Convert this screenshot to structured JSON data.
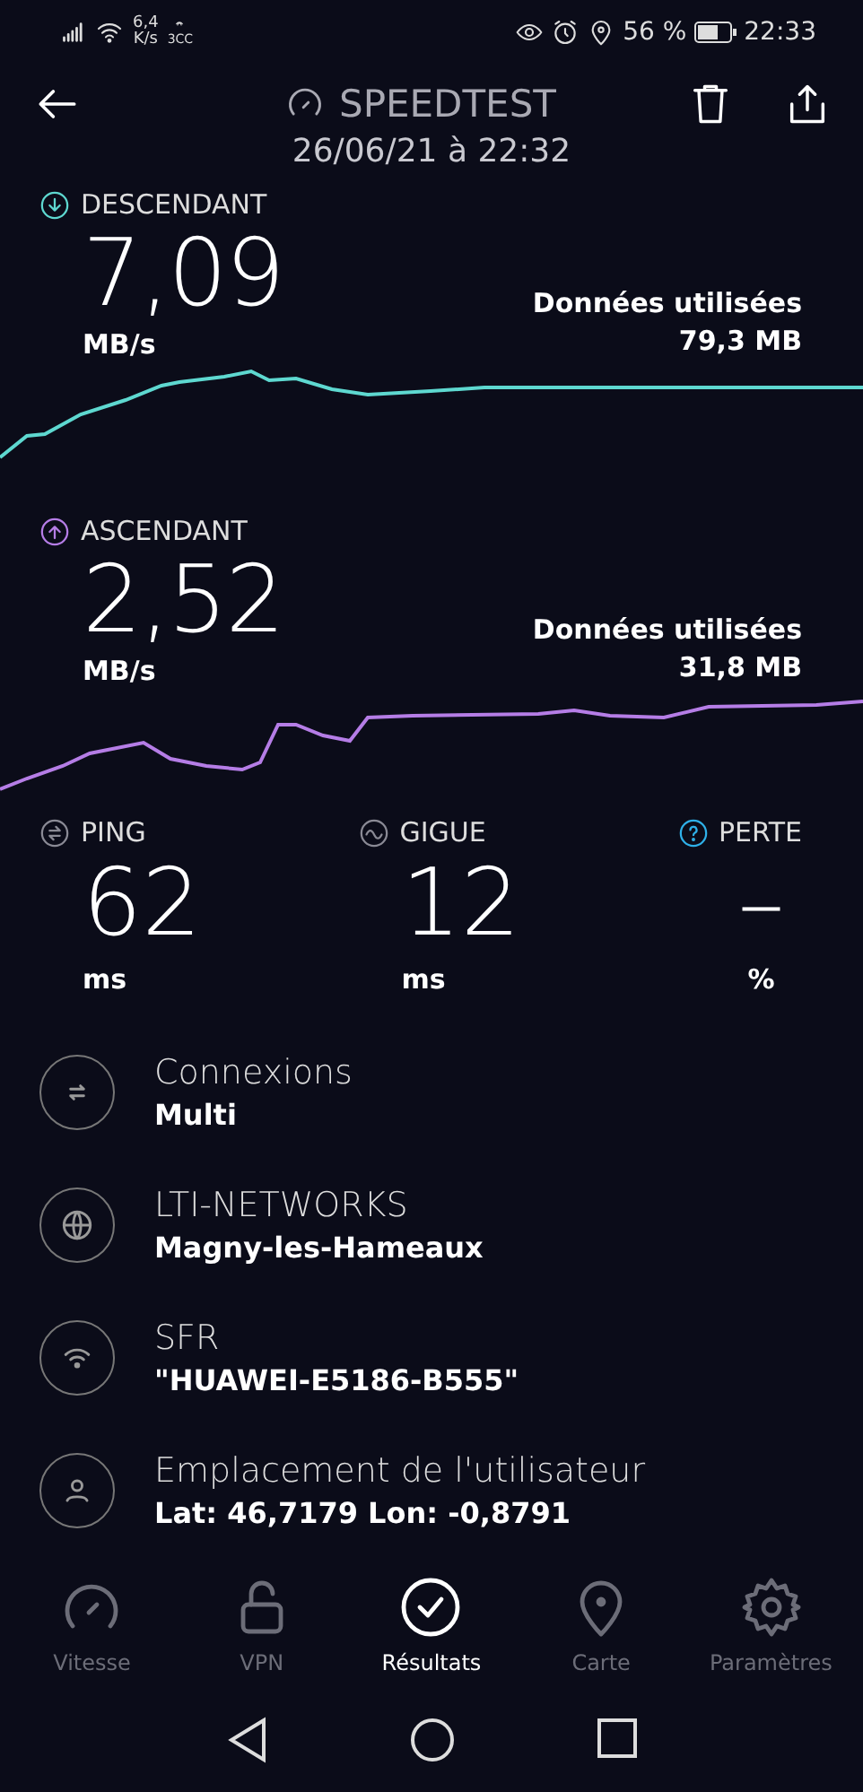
{
  "status_bar": {
    "speed": "6,4",
    "speed_unit": "K/s",
    "badge": "3CC",
    "battery": "56 %",
    "time": "22:33"
  },
  "header": {
    "title": "SPEEDTEST",
    "date": "26/06/21 à 22:32"
  },
  "tests": [
    {
      "kind": "download",
      "label": "DESCENDANT",
      "value": "7,09",
      "unit": "MB/s",
      "data_label": "Données utilisées",
      "data_value": "79,3 MB",
      "color": "#5ed8d0"
    },
    {
      "kind": "upload",
      "label": "ASCENDANT",
      "value": "2,52",
      "unit": "MB/s",
      "data_label": "Données utilisées",
      "data_value": "31,8 MB",
      "color": "#b57de6"
    }
  ],
  "metrics": [
    {
      "kind": "ping",
      "label": "PING",
      "value": "62",
      "unit": "ms"
    },
    {
      "kind": "jitter",
      "label": "GIGUE",
      "value": "12",
      "unit": "ms"
    },
    {
      "kind": "loss",
      "label": "PERTE",
      "value": "–",
      "unit": "%"
    }
  ],
  "details": [
    {
      "kind": "connections",
      "title": "Connexions",
      "subtitle": "Multi"
    },
    {
      "kind": "server",
      "title": "LTI-NETWORKS",
      "subtitle": "Magny-les-Hameaux"
    },
    {
      "kind": "wifi",
      "title": "SFR",
      "subtitle": "\"HUAWEI-E5186-B555\""
    },
    {
      "kind": "user",
      "title": "Emplacement de l'utilisateur",
      "subtitle": "Lat: 46,7179 Lon: -0,8791"
    }
  ],
  "tabs": [
    {
      "kind": "speed",
      "label": "Vitesse",
      "selected": false
    },
    {
      "kind": "vpn",
      "label": "VPN",
      "selected": false
    },
    {
      "kind": "results",
      "label": "Résultats",
      "selected": true
    },
    {
      "kind": "map",
      "label": "Carte",
      "selected": false
    },
    {
      "kind": "settings",
      "label": "Paramètres",
      "selected": false
    }
  ]
}
